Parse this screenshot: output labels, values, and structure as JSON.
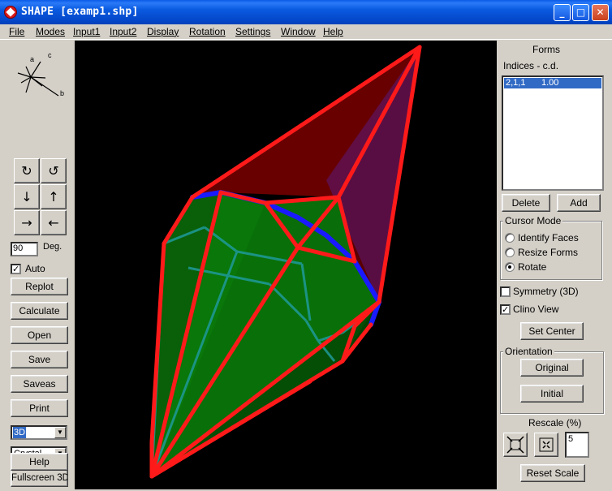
{
  "window": {
    "title": "SHAPE [examp1.shp]"
  },
  "menu": [
    "File",
    "Modes",
    "Input1",
    "Input2",
    "Display",
    "Rotation",
    "Settings",
    "Window",
    "Help"
  ],
  "axes": {
    "a": "a",
    "b": "b",
    "c": "c"
  },
  "rotation": {
    "buttons": [
      "rotate-cw",
      "rotate-ccw",
      "arrow-down",
      "arrow-up",
      "arrow-right",
      "arrow-left"
    ],
    "glyphs": [
      "↻",
      "↺",
      "↓",
      "↑",
      "→",
      "←"
    ],
    "degrees_value": "90",
    "degrees_label": "Deg.",
    "auto_label": "Auto",
    "auto_checked": true
  },
  "left_buttons": {
    "replot": "Replot",
    "calculate": "Calculate",
    "open": "Open",
    "save": "Save",
    "saveas": "Saveas",
    "print": "Print",
    "fullscreen": "Fullscreen 3D",
    "help": "Help"
  },
  "view_mode_select": "3D",
  "style_select": "Crystal",
  "forms": {
    "title": "Forms",
    "header": "Indices - c.d.",
    "rows": [
      {
        "indices": "2,1,1",
        "cd": "1.00"
      }
    ],
    "delete_label": "Delete",
    "add_label": "Add"
  },
  "cursor_mode": {
    "title": "Cursor Mode",
    "options": [
      "Identify Faces",
      "Resize Forms",
      "Rotate"
    ],
    "selected_index": 2
  },
  "symmetry": {
    "label": "Symmetry (3D)",
    "checked": false
  },
  "clino": {
    "label": "Clino View",
    "checked": true
  },
  "set_center_label": "Set Center",
  "orientation": {
    "title": "Orientation",
    "original_label": "Original",
    "initial_label": "Initial"
  },
  "rescale": {
    "title": "Rescale (%)",
    "value": "5",
    "reset_label": "Reset Scale"
  },
  "colors": {
    "face_green": "#0a7a0a",
    "face_red": "#7a0000",
    "edge_red": "#ff1a1a",
    "edge_blue": "#1a1aff",
    "hidden_cyan": "#1f9a9a",
    "selection": "#316ac5"
  }
}
